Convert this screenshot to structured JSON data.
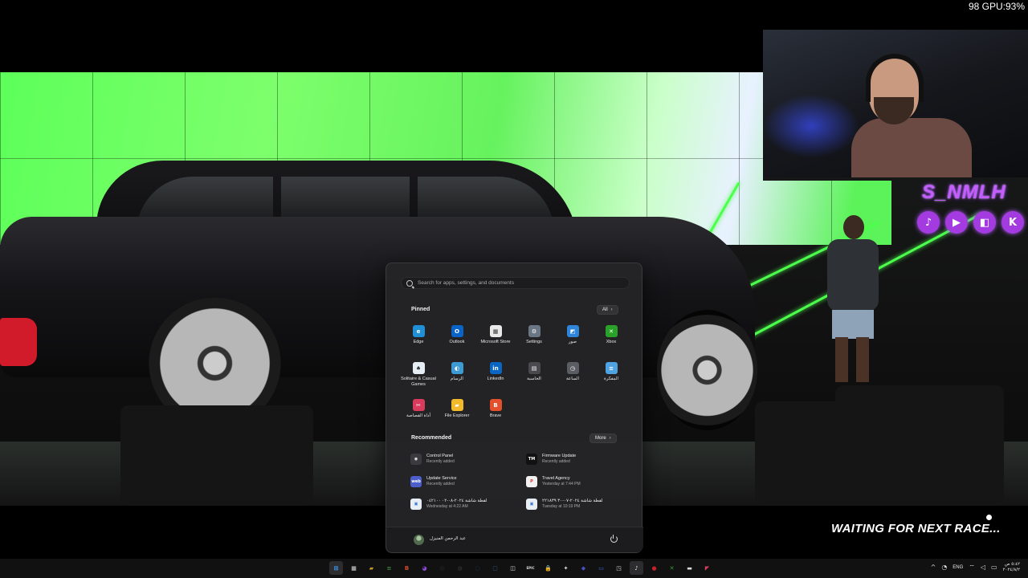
{
  "overlay": {
    "gpu_readout": "98 GPU:93%",
    "streamer_name": "S_NMLH",
    "social_icons": [
      {
        "icon": "tiktok-icon",
        "glyph": "♪"
      },
      {
        "icon": "youtube-icon",
        "glyph": "▶"
      },
      {
        "icon": "twitch-icon",
        "glyph": "◧"
      },
      {
        "icon": "kick-icon",
        "glyph": "K"
      }
    ],
    "status_text": "WAITING FOR NEXT RACE..."
  },
  "start_menu": {
    "search": {
      "placeholder": "Search for apps, settings, and documents"
    },
    "pinned": {
      "title": "Pinned",
      "all_label": "All",
      "apps": [
        {
          "label": "Edge",
          "icon": "edge-icon",
          "glyph": "e",
          "color": "#1f8fd6"
        },
        {
          "label": "Outlook",
          "icon": "outlook-icon",
          "glyph": "O",
          "color": "#0a64c8"
        },
        {
          "label": "Microsoft Store",
          "icon": "store-icon",
          "glyph": "▦",
          "color": "#e9e9e9"
        },
        {
          "label": "Settings",
          "icon": "settings-icon",
          "glyph": "⚙",
          "color": "#6b7684"
        },
        {
          "label": "صور",
          "icon": "photos-icon",
          "glyph": "◩",
          "color": "#2f86d9"
        },
        {
          "label": "Xbox",
          "icon": "xbox-icon",
          "glyph": "✕",
          "color": "#2aa22a"
        },
        {
          "label": "Solitaire & Casual Games",
          "icon": "solitaire-icon",
          "glyph": "♠",
          "color": "#e6eef5"
        },
        {
          "label": "الرسام",
          "icon": "paint-icon",
          "glyph": "◐",
          "color": "#3d9bd4"
        },
        {
          "label": "LinkedIn",
          "icon": "linkedin-icon",
          "glyph": "in",
          "color": "#0a66c2"
        },
        {
          "label": "الحاسبة",
          "icon": "calculator-icon",
          "glyph": "▤",
          "color": "#4a4a4e"
        },
        {
          "label": "الساعة",
          "icon": "clock-icon",
          "glyph": "◷",
          "color": "#5a5d63"
        },
        {
          "label": "المفكرة",
          "icon": "notepad-icon",
          "glyph": "≡",
          "color": "#4fa3e0"
        },
        {
          "label": "أداة القصاصة",
          "icon": "snipping-tool-icon",
          "glyph": "✂",
          "color": "#d93b5c"
        },
        {
          "label": "File Explorer",
          "icon": "file-explorer-icon",
          "glyph": "▰",
          "color": "#f2b92c"
        },
        {
          "label": "Brave",
          "icon": "brave-icon",
          "glyph": "B",
          "color": "#e5502c"
        }
      ]
    },
    "recommended": {
      "title": "Recommended",
      "more_label": "More",
      "items": [
        {
          "name": "Control Panel",
          "time": "Recently added",
          "icon": "control-panel-icon",
          "glyph": "◉",
          "color": "#3b3b3f"
        },
        {
          "name": "Firmware Update",
          "time": "Recently added",
          "icon": "firmware-icon",
          "glyph": "TM",
          "color": "#111"
        },
        {
          "name": "Update Service",
          "time": "Recently added",
          "icon": "update-service-icon",
          "glyph": "web",
          "color": "#4b5ec9"
        },
        {
          "name": "Travel Agency",
          "time": "Yesterday at 7:44 PM",
          "icon": "travel-agency-icon",
          "glyph": "P",
          "color": "#f1f1f1"
        },
        {
          "name": "لقطة شاشة ٢٠٢٤-٠٨-٠٢ ٠٤٢١٠٠",
          "time": "Wednesday at 4:22 AM",
          "icon": "screenshot-file-icon",
          "glyph": "▣",
          "color": "#e8eef6"
        },
        {
          "name": "لقطة شاشة ٢٠٢٤-٠٧-٣٠ ٢٢١٨٣٩",
          "time": "Tuesday at 10:19 PM",
          "icon": "screenshot-file-icon",
          "glyph": "▣",
          "color": "#e8eef6"
        }
      ]
    },
    "user": {
      "name": "عبد الرحمن المنيزل"
    }
  },
  "taskbar": {
    "icons": [
      {
        "icon": "start-icon",
        "glyph": "⊞",
        "color": "#3aa0ff",
        "active": true
      },
      {
        "icon": "calendar-icon",
        "glyph": "▦",
        "color": "#2a2a2e",
        "active": false
      },
      {
        "icon": "file-explorer-icon",
        "glyph": "▰",
        "color": "#c9962a",
        "active": false
      },
      {
        "icon": "notepad-icon",
        "glyph": "≡",
        "color": "#3a8a3a",
        "active": false
      },
      {
        "icon": "brave-icon",
        "glyph": "B",
        "color": "#d8492a",
        "active": false
      },
      {
        "icon": "messenger-icon",
        "glyph": "◕",
        "color": "#8b4bd6",
        "active": false
      },
      {
        "icon": "discord-icon",
        "glyph": "◎",
        "color": "#2c2c30",
        "active": false
      },
      {
        "icon": "obs-icon",
        "glyph": "◍",
        "color": "#3a3a3e",
        "active": false
      },
      {
        "icon": "steam-icon",
        "glyph": "◌",
        "color": "#2d4766",
        "active": false
      },
      {
        "icon": "window-icon",
        "glyph": "▢",
        "color": "#2e5a88",
        "active": false
      },
      {
        "icon": "app-icon",
        "glyph": "◫",
        "color": "#2a2a2e",
        "active": false
      },
      {
        "icon": "epic-games-icon",
        "glyph": "EPIC",
        "color": "#2b2b2b",
        "active": false
      },
      {
        "icon": "lock-icon",
        "glyph": "🔒",
        "color": "#2a8a4a",
        "active": false
      },
      {
        "icon": "controller-icon",
        "glyph": "✦",
        "color": "#2a2a2e",
        "active": false
      },
      {
        "icon": "diamond-icon",
        "glyph": "◆",
        "color": "#4a4fc4",
        "active": false
      },
      {
        "icon": "monitor-icon",
        "glyph": "▭",
        "color": "#3a6ad4",
        "active": false
      },
      {
        "icon": "capture-icon",
        "glyph": "◳",
        "color": "#2a2a2e",
        "active": false
      },
      {
        "icon": "tiktok-icon",
        "glyph": "♪",
        "color": "#1e1e22",
        "active": true
      },
      {
        "icon": "record-icon",
        "glyph": "●",
        "color": "#c4202a",
        "active": false
      },
      {
        "icon": "xbox-icon",
        "glyph": "✕",
        "color": "#2aa22a",
        "active": false
      },
      {
        "icon": "car-icon",
        "glyph": "▬",
        "color": "#2a2a2e",
        "active": false
      },
      {
        "icon": "game-icon",
        "glyph": "◤",
        "color": "#d93b5c",
        "active": false
      }
    ],
    "tray": {
      "chevron": "^",
      "language": "ENG",
      "time": "٥:٤٢ ص",
      "date": "٢٠٢٤/٨/٢"
    }
  }
}
